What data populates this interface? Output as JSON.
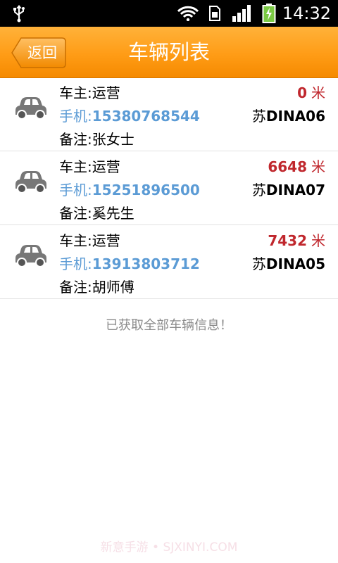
{
  "status_bar": {
    "time": "14:32",
    "icons": [
      "usb-icon",
      "wifi-icon",
      "sim-icon",
      "signal-icon",
      "battery-charging-icon"
    ]
  },
  "header": {
    "back_label": "返回",
    "title": "车辆列表",
    "color": "#ff9c16"
  },
  "vehicles": [
    {
      "owner": "车主:运营",
      "phone_label": "手机:",
      "phone": "15380768544",
      "note": "备注:张女士",
      "distance": "0",
      "unit": "米",
      "plate_prefix": "苏",
      "plate_code": "DINA06"
    },
    {
      "owner": "车主:运营",
      "phone_label": "手机:",
      "phone": "15251896500",
      "note": "备注:奚先生",
      "distance": "6648",
      "unit": "米",
      "plate_prefix": "苏",
      "plate_code": "DINA07"
    },
    {
      "owner": "车主:运营",
      "phone_label": "手机:",
      "phone": "13913803712",
      "note": "备注:胡师傅",
      "distance": "7432",
      "unit": "米",
      "plate_prefix": "苏",
      "plate_code": "DINA05"
    }
  ],
  "footer_message": "已获取全部车辆信息！",
  "watermark": "新意手游 • SJXINYI.COM",
  "colors": {
    "phone": "#5b9bd5",
    "distance": "#c0272d",
    "hint": "#8a8a8a"
  }
}
